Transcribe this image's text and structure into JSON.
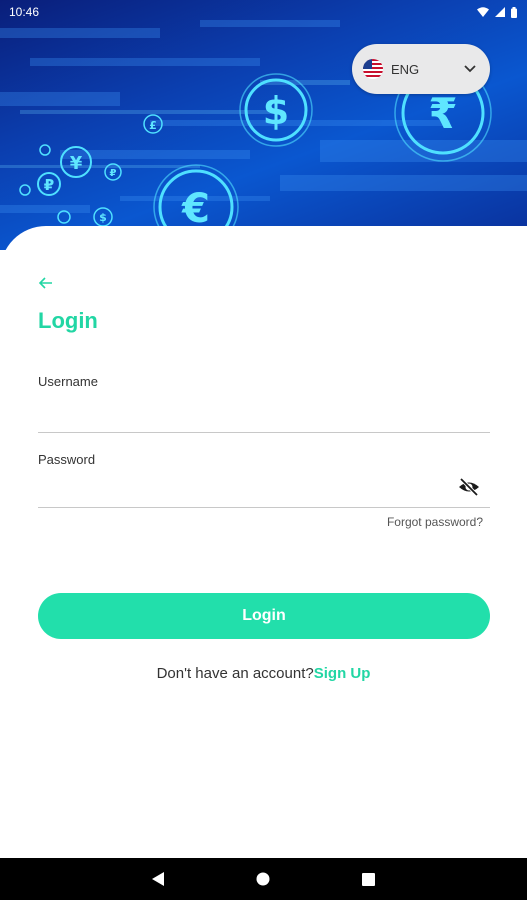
{
  "status_bar": {
    "time": "10:46"
  },
  "language": {
    "selected": "ENG"
  },
  "icons": {
    "back": "arrow-left-icon",
    "eye": "eye-off-icon",
    "chevron": "chevron-down-icon",
    "flag": "us-flag-icon"
  },
  "login": {
    "title": "Login",
    "username_label": "Username",
    "username_value": "",
    "password_label": "Password",
    "password_value": "",
    "forgot": "Forgot password?",
    "button": "Login",
    "no_account": "Don't have an account?",
    "signup": "Sign Up"
  },
  "colors": {
    "accent": "#22d6a4",
    "button": "#22dfab",
    "hero": "#0b3fb0"
  }
}
